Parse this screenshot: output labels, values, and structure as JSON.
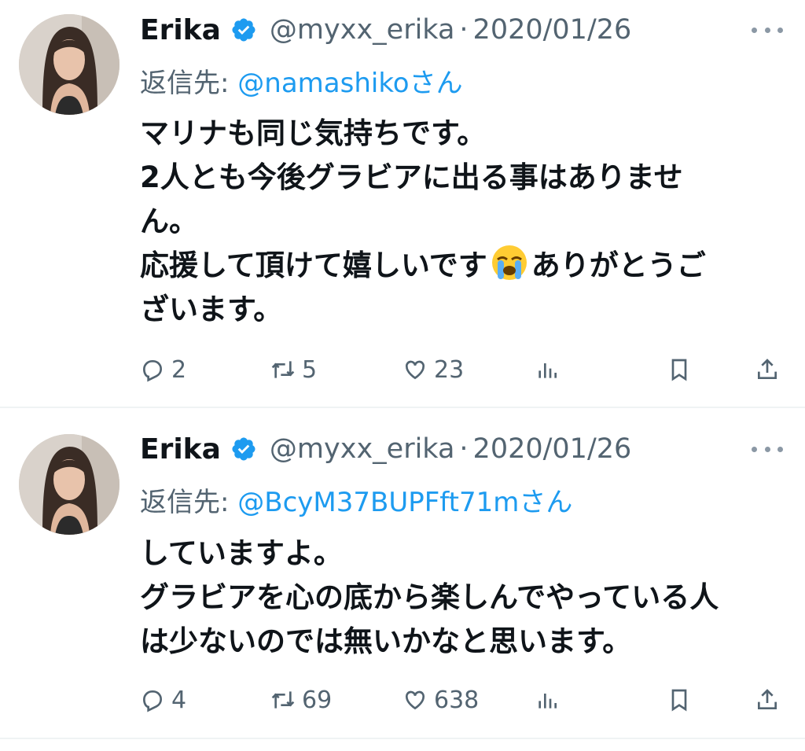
{
  "tweets": [
    {
      "name": "Erika",
      "handle": "@myxx_erika",
      "separator": "·",
      "date": "2020/01/26",
      "reply_label": "返信先:",
      "reply_mention": "@namashiko",
      "reply_suffix": "さん",
      "lines": [
        "マリナも同じ気持ちです。",
        "2人とも今後グラビアに出る事はありませ",
        "ん。",
        "応援して頂けて嬉しいです",
        "ありがとうご",
        "ざいます。"
      ],
      "emoji": "loudly-crying-face",
      "stats": {
        "replies": "2",
        "retweets": "5",
        "likes": "23"
      }
    },
    {
      "name": "Erika",
      "handle": "@myxx_erika",
      "separator": "·",
      "date": "2020/01/26",
      "reply_label": "返信先:",
      "reply_mention": "@BcyM37BUPFft71m",
      "reply_suffix": "さん",
      "lines": [
        "していますよ。",
        "グラビアを心の底から楽しんでやっている人",
        "は少ないのでは無いかなと思います。"
      ],
      "stats": {
        "replies": "4",
        "retweets": "69",
        "likes": "638"
      }
    }
  ],
  "colors": {
    "text": "#0f1419",
    "secondary": "#536471",
    "accent": "#1d9bf0",
    "divider": "#eff3f4"
  },
  "icons": [
    "verified-badge-icon",
    "more-icon",
    "reply-icon",
    "retweet-icon",
    "like-icon",
    "views-icon",
    "bookmark-icon",
    "share-icon"
  ]
}
